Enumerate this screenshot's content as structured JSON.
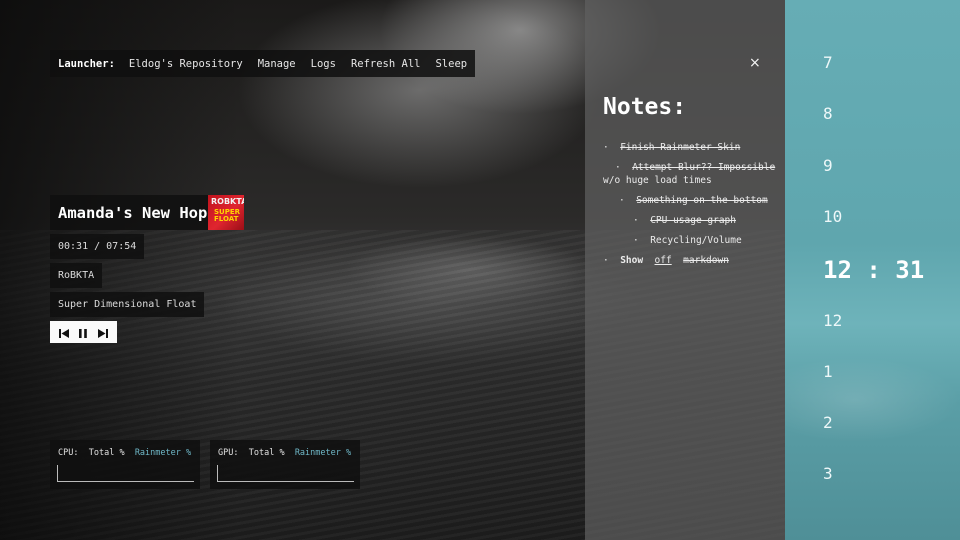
{
  "launcher": {
    "label": "Launcher:",
    "items": [
      "Eldog's Repository",
      "Manage",
      "Logs",
      "Refresh All",
      "Sleep"
    ]
  },
  "player": {
    "title": "Amanda's New Hope",
    "time": "00:31 / 07:54",
    "artist": "RoBKTA",
    "album": "Super Dimensional Float",
    "cover_top": "ROBKTA",
    "cover_bottom": "SUPER FLOAT",
    "controls": [
      "previous-icon",
      "pause-icon",
      "next-icon"
    ]
  },
  "meters": {
    "cpu": {
      "label": "CPU:",
      "total": "Total %",
      "app": "Rainmeter %"
    },
    "gpu": {
      "label": "GPU:",
      "total": "Total %",
      "app": "Rainmeter %"
    },
    "accent_color": "#6fb8c8"
  },
  "notes": {
    "close_symbol": "×",
    "title": "Notes:",
    "bullet": "·",
    "items": [
      {
        "text": "Finish Rainmeter Skin",
        "done": true
      },
      {
        "text": "Attempt Blur?? Impossible",
        "done": true,
        "continuation": "w/o huge load times"
      },
      {
        "text": "Something on the bottom",
        "done": true
      },
      {
        "text": "CPU usage graph",
        "done": true
      },
      {
        "text": "Recycling/Volume",
        "done": false
      },
      {
        "show": "Show",
        "off": "off",
        "markdown": "markdown"
      }
    ]
  },
  "clock": {
    "hours_before": [
      "7",
      "8",
      "9",
      "10"
    ],
    "current": "12 : 31",
    "hours_after": [
      "12",
      "1",
      "2",
      "3"
    ]
  }
}
